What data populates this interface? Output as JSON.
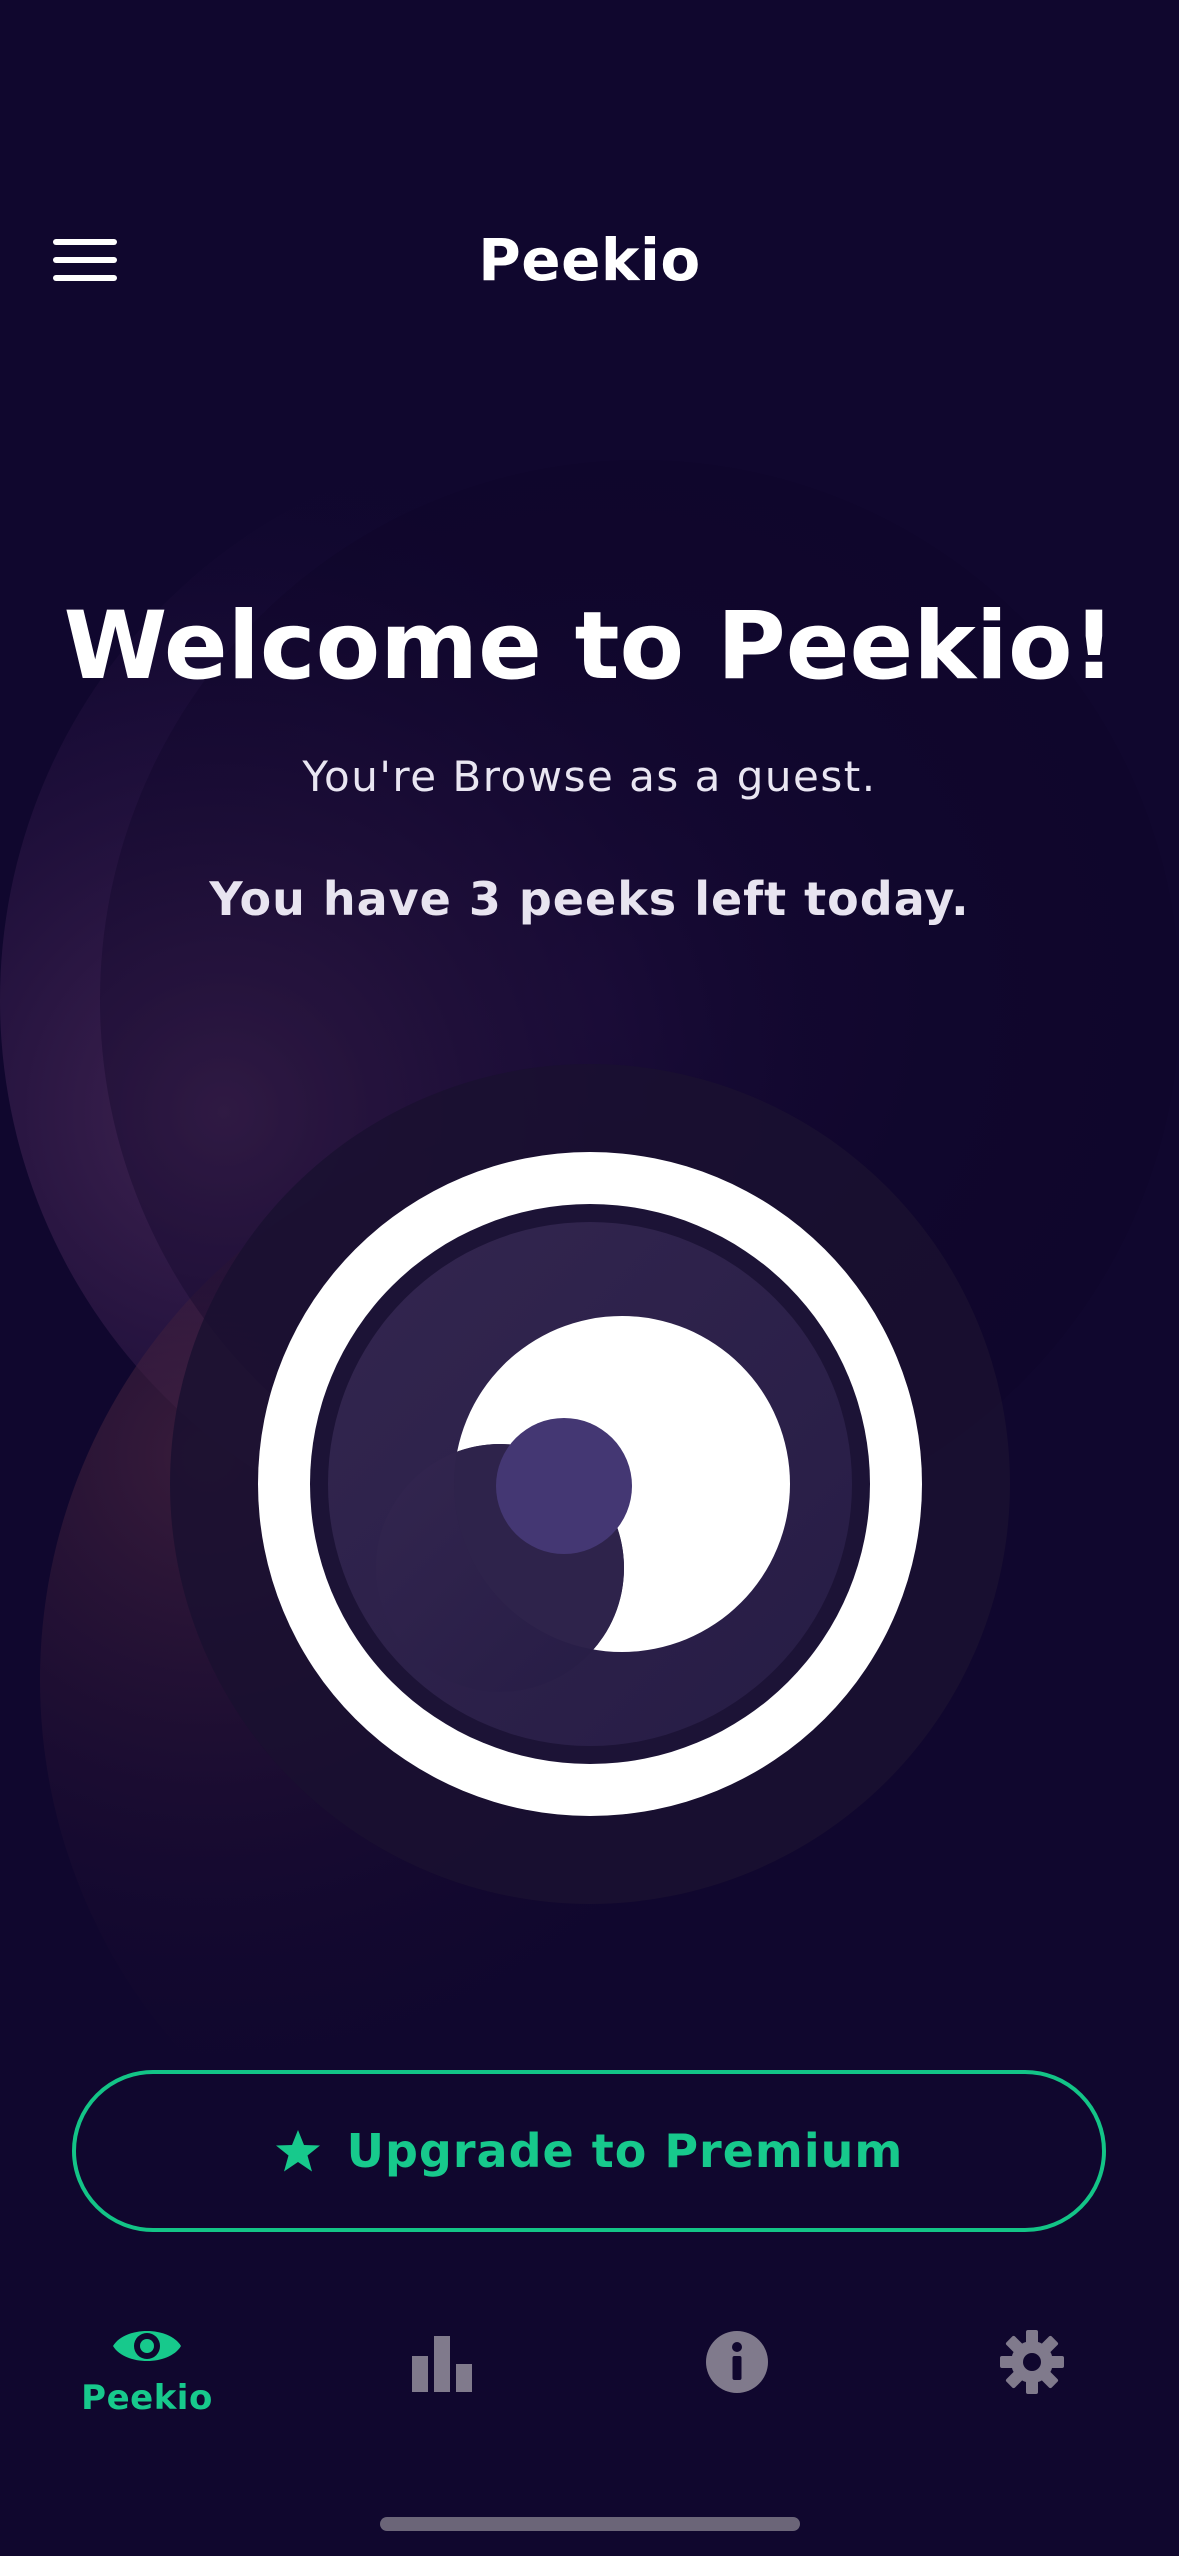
{
  "header": {
    "title": "Peekio",
    "menu_icon": "hamburger-menu-icon"
  },
  "hero": {
    "welcome": "Welcome to Peekio!",
    "guest_status": "You're Browse as a guest.",
    "peeks_remaining": "You have 3 peeks left today."
  },
  "eye_button": {
    "icon": "peek-eye-icon"
  },
  "upgrade": {
    "label": "Upgrade to Premium",
    "icon": "star-icon"
  },
  "tabs": [
    {
      "label": "Peekio",
      "icon": "eye-icon",
      "active": true
    },
    {
      "label": "",
      "icon": "bar-chart-icon",
      "active": false
    },
    {
      "label": "",
      "icon": "info-icon",
      "active": false
    },
    {
      "label": "",
      "icon": "gear-icon",
      "active": false
    }
  ],
  "colors": {
    "background": "#10072e",
    "accent": "#17c98c",
    "inactive_icon": "#807a8c",
    "text": "#ffffff"
  }
}
